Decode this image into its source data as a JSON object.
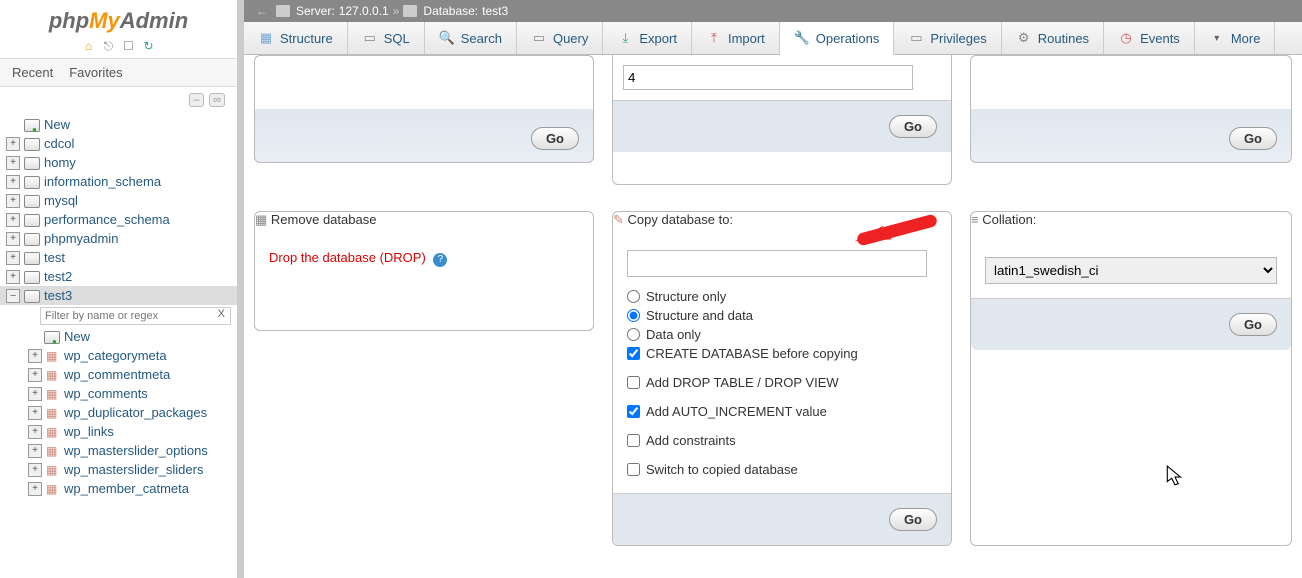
{
  "logo": {
    "php": "php",
    "my": "My",
    "admin": "Admin"
  },
  "sidebar": {
    "recent": "Recent",
    "favorites": "Favorites",
    "new": "New",
    "filter_placeholder": "Filter by name or regex",
    "databases": [
      "cdcol",
      "homy",
      "information_schema",
      "mysql",
      "performance_schema",
      "phpmyadmin",
      "test",
      "test2",
      "test3"
    ],
    "active_db": "test3",
    "active_tables": [
      "wp_categorymeta",
      "wp_commentmeta",
      "wp_comments",
      "wp_duplicator_packages",
      "wp_links",
      "wp_masterslider_options",
      "wp_masterslider_sliders",
      "wp_member_catmeta"
    ]
  },
  "breadcrumb": {
    "server_label": "Server:",
    "server_value": "127.0.0.1",
    "db_label": "Database:",
    "db_value": "test3"
  },
  "tabs": {
    "structure": "Structure",
    "sql": "SQL",
    "search": "Search",
    "query": "Query",
    "export": "Export",
    "import": "Import",
    "operations": "Operations",
    "privileges": "Privileges",
    "routines": "Routines",
    "events": "Events",
    "more": "More"
  },
  "go": "Go",
  "top_input_value": "4",
  "remove": {
    "legend": "Remove database",
    "drop_text": "Drop the database (DROP)"
  },
  "copy": {
    "legend": "Copy database to:",
    "structure_only": "Structure only",
    "structure_data": "Structure and data",
    "data_only": "Data only",
    "create_before": "CREATE DATABASE before copying",
    "drop_table": "Add DROP TABLE / DROP VIEW",
    "auto_inc": "Add AUTO_INCREMENT value",
    "constraints": "Add constraints",
    "switch": "Switch to copied database"
  },
  "collation": {
    "legend": "Collation:",
    "value": "latin1_swedish_ci"
  }
}
